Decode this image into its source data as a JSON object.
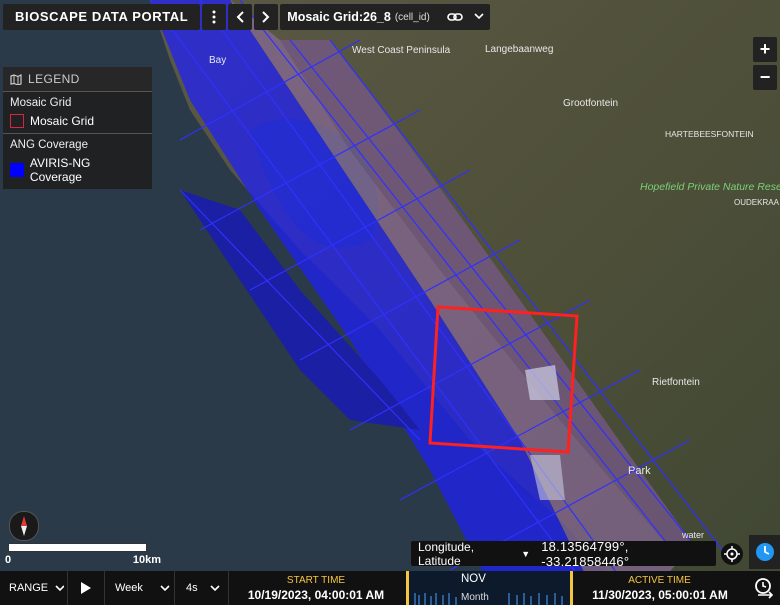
{
  "app": {
    "title": "BIOSCAPE DATA PORTAL"
  },
  "toolbar": {
    "grid_title": "Mosaic Grid:26_8",
    "grid_sub": "(cell_id)"
  },
  "legend": {
    "header": "LEGEND",
    "sections": [
      {
        "title": "Mosaic Grid",
        "item": "Mosaic Grid",
        "color": "#d7263d",
        "style": "outline"
      },
      {
        "title": "ANG Coverage",
        "item": "AVIRIS-NG Coverage",
        "color": "#0000ff",
        "style": "fill"
      }
    ]
  },
  "map": {
    "place_labels": [
      "West Coast Peninsula",
      "Langebaanweg",
      "Grootfontein",
      "HARTEBEESFONTEIN",
      "Hopefield Private Nature Reserve",
      "OUDEKRAA",
      "Rietfontein",
      "Bay",
      "Park",
      "water"
    ],
    "colors": {
      "ocean": "#2c3c4c",
      "land": "#5c5a42",
      "coverage": "#1d1dff",
      "highlight": "#ff2020"
    }
  },
  "zoom": {
    "in": "+",
    "out": "−"
  },
  "scale": {
    "start": "0",
    "end": "10km"
  },
  "coords": {
    "mode": "Longitude, Latitude",
    "value": "18.13564799°, -33.21858446°"
  },
  "timebar": {
    "range_label": "RANGE",
    "step": "Week",
    "speed": "4s",
    "start_label": "START TIME",
    "start_value": "10/19/2023, 04:00:01 AM",
    "month": "NOV",
    "unit": "Month",
    "active_label": "ACTIVE TIME",
    "active_value": "11/30/2023, 05:00:01 AM"
  }
}
